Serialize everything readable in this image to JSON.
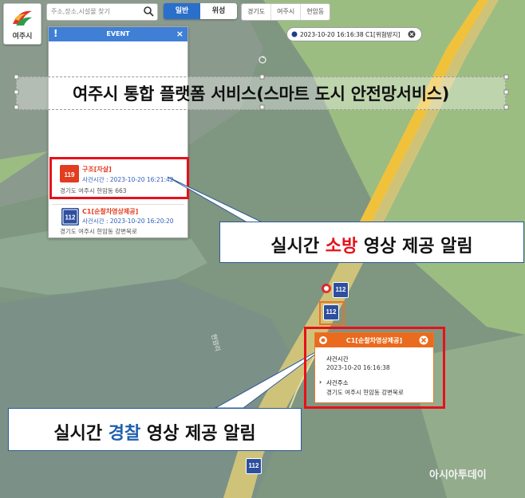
{
  "app": {
    "logo_label": "여주시"
  },
  "search": {
    "placeholder": "주소,장소,시설물 찾기"
  },
  "map_type": {
    "normal": "일반",
    "satellite": "위성"
  },
  "breadcrumb": {
    "items": [
      "경기도",
      "여주시",
      "현암동"
    ]
  },
  "event_panel": {
    "title": "EVENT",
    "items": [
      {
        "title": "구조[자살]",
        "time": "사건시간 : 2023-10-20 16:21:42",
        "address": "경기도 여주시 현암동 663"
      },
      {
        "title": "C1[순찰차영상제공]",
        "time": "사건시간 : 2023-10-20 16:20:20",
        "address": "경기도 여주시 현암동 강변북로"
      }
    ]
  },
  "time_pill": {
    "text": "2023-10-20 16:16:38 C1[위험방지]"
  },
  "banner": {
    "title": "여주시 통합 플랫폼 서비스(스마트 도시 안전망서비스)"
  },
  "callouts": {
    "fire": {
      "before": "실시간 ",
      "highlight": "소방",
      "after": " 영상 제공 알림"
    },
    "police": {
      "before": "실시간 ",
      "highlight": "경찰",
      "after": " 영상 제공 알림"
    }
  },
  "popup": {
    "title": "C1[순찰차영상제공]",
    "time_label": "사건시간",
    "time_value": "2023-10-20 16:16:38",
    "addr_label": "사건주소",
    "addr_value": "경기도 여주시 현암동 강변북로"
  },
  "markers": {
    "label": "112"
  },
  "map_label": "현암리",
  "watermark": "아시아투데이",
  "colors": {
    "fire_red": "#e8101a",
    "police_blue": "#1f5fae",
    "accent": "#3f7fd6",
    "popup_orange": "#ea6a1e"
  }
}
